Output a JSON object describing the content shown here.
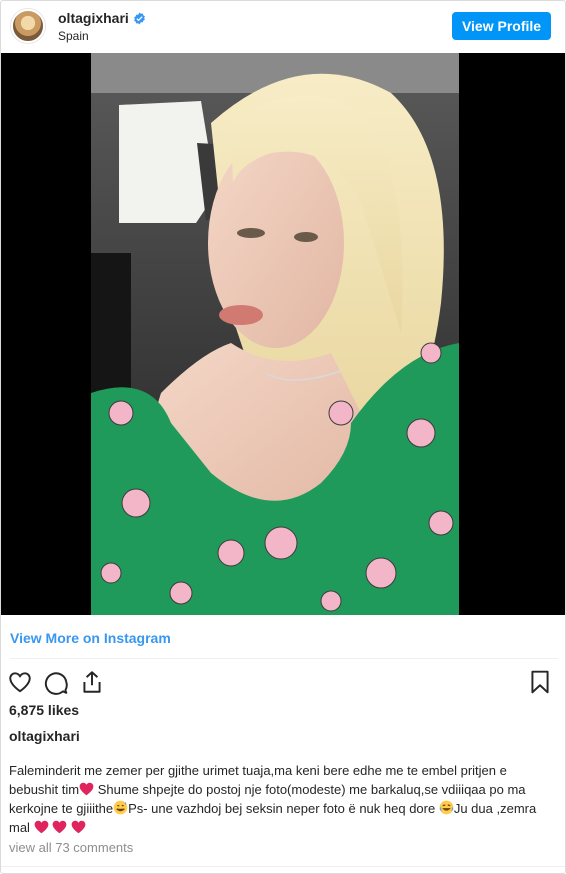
{
  "post": {
    "username": "oltagixhari",
    "location": "Spain",
    "view_profile_label": "View Profile",
    "view_more_label": "View More on Instagram",
    "likes": "6,875 likes",
    "caption_owner": "oltagixhari",
    "caption": {
      "part1": "Faleminderit me zemer per gjithe urimet tuaja,ma keni bere edhe me te embel pritjen e bebushit tim",
      "part2": " Shume shpejte do postoj nje foto(modeste) me barkaluq,se vdiiiqaa po ma kerkojne te gjiiithe",
      "part3": "Ps- une vazhdoj bej seksin neper foto ë nuk heq dore ",
      "part4": "Ju dua ,zemra mal "
    },
    "comments_link": "view all 73 comments"
  },
  "icons": {
    "verified": "verified-badge-icon",
    "like": "heart-icon",
    "comment": "comment-icon",
    "share": "share-icon",
    "save": "bookmark-icon",
    "heart_emoji": "red-heart-emoji",
    "sweat_smile": "sweat-smile-emoji",
    "joy": "joy-emoji"
  },
  "colors": {
    "accent": "#0095f6",
    "link": "#3897f0",
    "heart": "#e0245e",
    "dress": "#1f9a5b"
  }
}
